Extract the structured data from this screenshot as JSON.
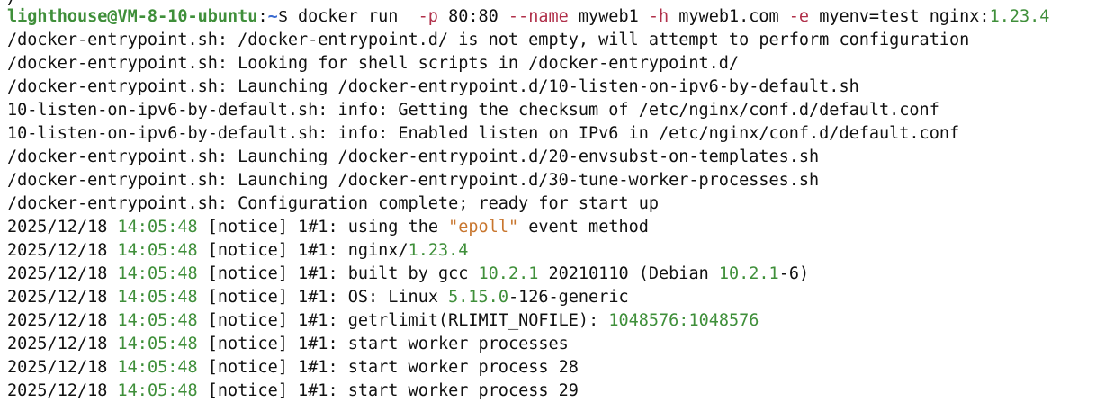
{
  "terminal": {
    "prompt": {
      "user_host": "lighthouse@VM-8-10-ubuntu",
      "colon": ":",
      "path": "~",
      "symbol": "$ "
    },
    "command": {
      "exec": "docker run  ",
      "flag_p": "-p",
      "port": " 80:80 ",
      "flag_name": "--name",
      "name": " myweb1 ",
      "flag_h": "-h",
      "host": " myweb1.com ",
      "flag_e": "-e",
      "env": " myenv=test nginx:",
      "tag": "1.23.4"
    },
    "partial_top": "/",
    "entrypoint_lines": [
      "/docker-entrypoint.sh: /docker-entrypoint.d/ is not empty, will attempt to perform configuration",
      "/docker-entrypoint.sh: Looking for shell scripts in /docker-entrypoint.d/",
      "/docker-entrypoint.sh: Launching /docker-entrypoint.d/10-listen-on-ipv6-by-default.sh",
      "10-listen-on-ipv6-by-default.sh: info: Getting the checksum of /etc/nginx/conf.d/default.conf",
      "10-listen-on-ipv6-by-default.sh: info: Enabled listen on IPv6 in /etc/nginx/conf.d/default.conf",
      "/docker-entrypoint.sh: Launching /docker-entrypoint.d/20-envsubst-on-templates.sh",
      "/docker-entrypoint.sh: Launching /docker-entrypoint.d/30-tune-worker-processes.sh",
      "/docker-entrypoint.sh: Configuration complete; ready for start up"
    ],
    "log_date": "2025/12/18",
    "log_time": "14:05:48",
    "log_level": "[notice]",
    "log_pid": "1#1:",
    "logs": {
      "l1_a": " using the ",
      "l1_b": "\"epoll\"",
      "l1_c": " event method",
      "l2_a": " nginx/",
      "l2_b": "1.23.4",
      "l3_a": " built by gcc ",
      "l3_b": "10.2.1",
      "l3_c": " 20210110 ",
      "l3_d": "(Debian ",
      "l3_e": "10.2.1",
      "l3_f": "-6",
      "l3_g": ")",
      "l4_a": " OS: Linux ",
      "l4_b": "5.15.0",
      "l4_c": "-126-generic",
      "l5_a": " getrlimit",
      "l5_b": "(RLIMIT_NOFILE)",
      "l5_c": ": ",
      "l5_d": "1048576:1048576",
      "l6_a": " start worker processes",
      "l7_a": " start worker process 28",
      "l8_a": " start worker process 29"
    }
  }
}
